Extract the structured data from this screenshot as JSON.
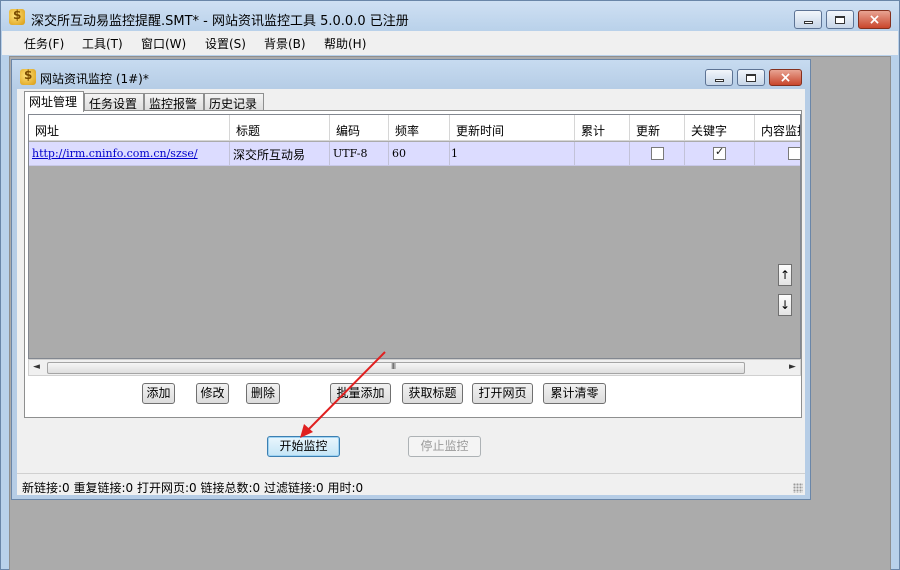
{
  "app": {
    "title": "深交所互动易监控提醒.SMT* - 网站资讯监控工具 5.0.0.0  已注册"
  },
  "menu": {
    "items": [
      "任务(F)",
      "工具(T)",
      "窗口(W)",
      "设置(S)",
      "背景(B)",
      "帮助(H)"
    ]
  },
  "child_window": {
    "title": "网站资讯监控  (1#)*"
  },
  "tabs": [
    "网址管理",
    "任务设置",
    "监控报警",
    "历史记录"
  ],
  "active_tab": "网址管理",
  "table": {
    "columns": [
      "网址",
      "标题",
      "编码",
      "频率",
      "更新时间",
      "累计",
      "更新",
      "关键字",
      "内容监控"
    ],
    "rows": [
      {
        "url": "http://irm.cninfo.com.cn/szse/",
        "title": "深交所互动易",
        "encoding": "UTF-8",
        "frequency": "60",
        "update_time": "1",
        "total": "",
        "update_checked": false,
        "keyword_checked": true,
        "content_monitor_checked": false
      }
    ]
  },
  "scroll": {
    "left_arrow": "◄",
    "right_arrow": "►",
    "grip": "III",
    "up_label": "↑",
    "down_label": "↓"
  },
  "buttons": {
    "add": "添加",
    "edit": "修改",
    "delete": "删除",
    "batch_add": "批量添加",
    "fetch_title": "获取标题",
    "open_page": "打开网页",
    "clear_total": "累计清零",
    "start": "开始监控",
    "stop": "停止监控"
  },
  "status": {
    "text": "新链接:0  重复链接:0  打开网页:0  链接总数:0  过滤链接:0  用时:0"
  },
  "colors": {
    "annotation_arrow": "#e02020",
    "row_highlight": "#dcdcff",
    "link": "#0000cc"
  }
}
